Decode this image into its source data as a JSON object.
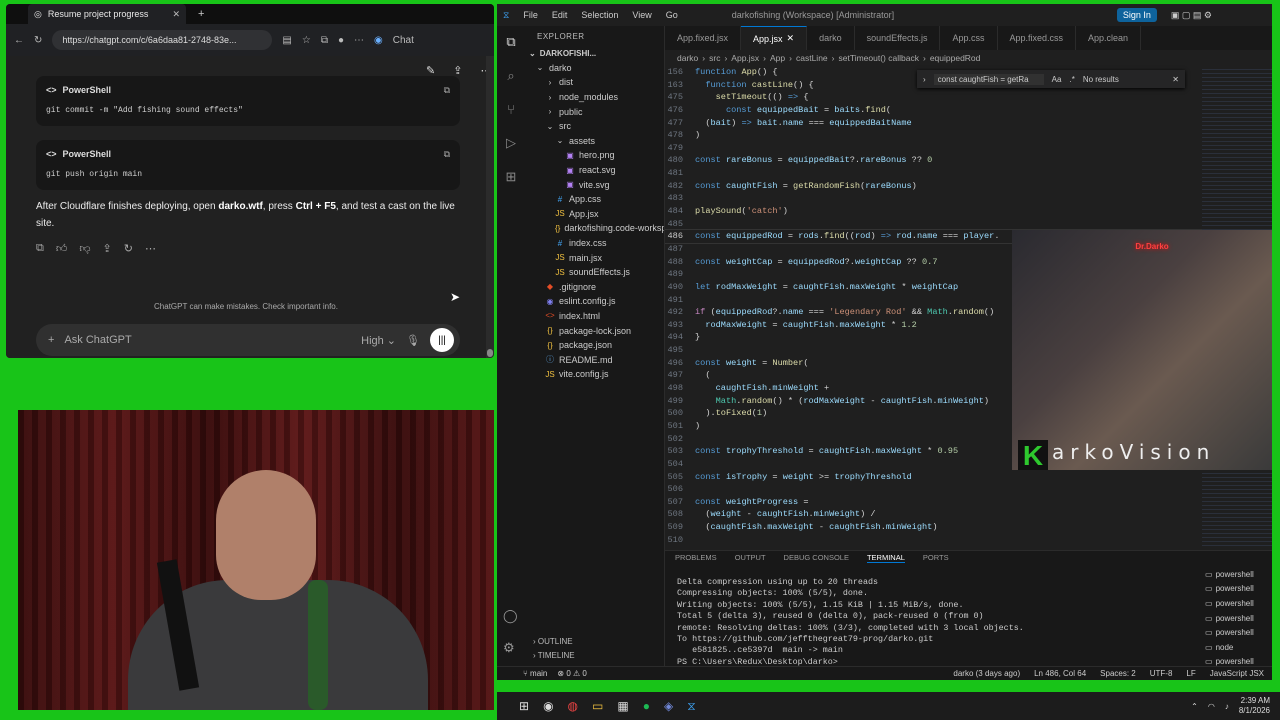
{
  "browser": {
    "tab_title": "Resume project progress",
    "url": "https://chatgpt.com/c/6a6daa81-2748-83e...",
    "chat_label": "Chat"
  },
  "chat": {
    "block1": {
      "lang": "PowerShell",
      "code": "git commit -m \"Add fishing sound effects\""
    },
    "block2": {
      "lang": "PowerShell",
      "code": "git push origin main"
    },
    "message_pre": "After Cloudflare finishes deploying, open ",
    "message_bold1": "darko.wtf",
    "message_mid": ", press ",
    "message_bold2": "Ctrl + F5",
    "message_post": ", and test a cast on the live site.",
    "disclaimer": "ChatGPT can make mistakes. Check important info.",
    "input_placeholder": "Ask ChatGPT",
    "model": "High"
  },
  "vscode": {
    "menu": [
      "File",
      "Edit",
      "Selection",
      "View",
      "Go"
    ],
    "window_title": "darkofishing (Workspace) [Administrator]",
    "sign_in": "Sign In",
    "explorer_header": "EXPLORER",
    "workspace": "DARKOFISHI...",
    "tree": [
      {
        "name": "darko",
        "type": "folder",
        "depth": 0,
        "open": true
      },
      {
        "name": "dist",
        "type": "folder",
        "depth": 1
      },
      {
        "name": "node_modules",
        "type": "folder",
        "depth": 1
      },
      {
        "name": "public",
        "type": "folder",
        "depth": 1
      },
      {
        "name": "src",
        "type": "folder",
        "depth": 1,
        "open": true
      },
      {
        "name": "assets",
        "type": "folder",
        "depth": 2,
        "open": true
      },
      {
        "name": "hero.png",
        "type": "img",
        "depth": 3
      },
      {
        "name": "react.svg",
        "type": "img",
        "depth": 3
      },
      {
        "name": "vite.svg",
        "type": "img",
        "depth": 3
      },
      {
        "name": "App.css",
        "type": "css",
        "depth": 2
      },
      {
        "name": "App.jsx",
        "type": "js",
        "depth": 2
      },
      {
        "name": "darkofishing.code-worksp...",
        "type": "json",
        "depth": 2
      },
      {
        "name": "index.css",
        "type": "css",
        "depth": 2
      },
      {
        "name": "main.jsx",
        "type": "js",
        "depth": 2
      },
      {
        "name": "soundEffects.js",
        "type": "js",
        "depth": 2
      },
      {
        "name": ".gitignore",
        "type": "git",
        "depth": 1
      },
      {
        "name": "eslint.config.js",
        "type": "eslint",
        "depth": 1
      },
      {
        "name": "index.html",
        "type": "html",
        "depth": 1
      },
      {
        "name": "package-lock.json",
        "type": "json",
        "depth": 1
      },
      {
        "name": "package.json",
        "type": "json",
        "depth": 1
      },
      {
        "name": "README.md",
        "type": "md",
        "depth": 1
      },
      {
        "name": "vite.config.js",
        "type": "js",
        "depth": 1
      }
    ],
    "outline": "OUTLINE",
    "timeline": "TIMELINE",
    "tabs": [
      "App.fixed.jsx",
      "App.jsx",
      "darko",
      "soundEffects.js",
      "App.css",
      "App.fixed.css",
      "App.clean"
    ],
    "active_tab": "App.jsx",
    "breadcrumbs": [
      "darko",
      "src",
      "App.jsx",
      "App",
      "castLine",
      "setTimeout() callback",
      "equippedRod"
    ],
    "find": {
      "query": "const caughtFish = getRa",
      "result": "No results"
    },
    "code_lines": [
      {
        "n": "156",
        "html": "<span class='kw'>function</span> <span class='fn'>App</span>() {"
      },
      {
        "n": "163",
        "html": "  <span class='kw'>function</span> <span class='fn'>castLine</span>() {"
      },
      {
        "n": "475",
        "html": "    <span class='fn'>setTimeout</span>(() <span class='kw'>=></span> {"
      },
      {
        "n": "476",
        "html": "      <span class='kw'>const</span> <span class='var'>equippedBait</span> = <span class='var'>baits</span>.<span class='fn'>find</span>("
      },
      {
        "n": "477",
        "html": "  (<span class='var'>bait</span>) <span class='kw'>=></span> <span class='var'>bait</span>.<span class='var'>name</span> === <span class='var'>equippedBaitName</span>"
      },
      {
        "n": "478",
        "html": ")"
      },
      {
        "n": "479",
        "html": ""
      },
      {
        "n": "480",
        "html": "<span class='kw'>const</span> <span class='var'>rareBonus</span> = <span class='var'>equippedBait</span>?.<span class='var'>rareBonus</span> ?? <span class='num'>0</span>"
      },
      {
        "n": "481",
        "html": ""
      },
      {
        "n": "482",
        "html": "<span class='kw'>const</span> <span class='var'>caughtFish</span> = <span class='fn'>getRandomFish</span>(<span class='var'>rareBonus</span>)"
      },
      {
        "n": "483",
        "html": ""
      },
      {
        "n": "484",
        "html": "<span class='fn'>playSound</span>(<span class='str'>'catch'</span>)"
      },
      {
        "n": "485",
        "html": ""
      },
      {
        "n": "486",
        "html": "<span class='kw'>const</span> <span class='var'>equippedRod</span> = <span class='var'>rods</span>.<span class='fn'>find</span>((<span class='var'>rod</span>) <span class='kw'>=></span> <span class='var'>rod</span>.<span class='var'>name</span> === <span class='var'>player</span>."
      },
      {
        "n": "487",
        "html": ""
      },
      {
        "n": "488",
        "html": "<span class='kw'>const</span> <span class='var'>weightCap</span> = <span class='var'>equippedRod</span>?.<span class='var'>weightCap</span> ?? <span class='num'>0.7</span>"
      },
      {
        "n": "489",
        "html": ""
      },
      {
        "n": "490",
        "html": "<span class='kw'>let</span> <span class='var'>rodMaxWeight</span> = <span class='var'>caughtFish</span>.<span class='var'>maxWeight</span> * <span class='var'>weightCap</span>"
      },
      {
        "n": "491",
        "html": ""
      },
      {
        "n": "492",
        "html": "<span class='ctl'>if</span> (<span class='var'>equippedRod</span>?.<span class='var'>name</span> === <span class='str'>'Legendary Rod'</span> &amp;&amp; <span class='cls'>Math</span>.<span class='fn'>random</span>()"
      },
      {
        "n": "493",
        "html": "  <span class='var'>rodMaxWeight</span> = <span class='var'>caughtFish</span>.<span class='var'>maxWeight</span> * <span class='num'>1.2</span>"
      },
      {
        "n": "494",
        "html": "}"
      },
      {
        "n": "495",
        "html": ""
      },
      {
        "n": "496",
        "html": "<span class='kw'>const</span> <span class='var'>weight</span> = <span class='fn'>Number</span>("
      },
      {
        "n": "497",
        "html": "  ("
      },
      {
        "n": "498",
        "html": "    <span class='var'>caughtFish</span>.<span class='var'>minWeight</span> +"
      },
      {
        "n": "499",
        "html": "    <span class='cls'>Math</span>.<span class='fn'>random</span>() * (<span class='var'>rodMaxWeight</span> - <span class='var'>caughtFish</span>.<span class='var'>minWeight</span>)"
      },
      {
        "n": "500",
        "html": "  ).<span class='fn'>toFixed</span>(<span class='num'>1</span>)"
      },
      {
        "n": "501",
        "html": ")"
      },
      {
        "n": "502",
        "html": ""
      },
      {
        "n": "503",
        "html": "<span class='kw'>const</span> <span class='var'>trophyThreshold</span> = <span class='var'>caughtFish</span>.<span class='var'>maxWeight</span> * <span class='num'>0.95</span>"
      },
      {
        "n": "504",
        "html": ""
      },
      {
        "n": "505",
        "html": "<span class='kw'>const</span> <span class='var'>isTrophy</span> = <span class='var'>weight</span> >= <span class='var'>trophyThreshold</span>"
      },
      {
        "n": "506",
        "html": ""
      },
      {
        "n": "507",
        "html": "<span class='kw'>const</span> <span class='var'>weightProgress</span> ="
      },
      {
        "n": "508",
        "html": "  (<span class='var'>weight</span> - <span class='var'>caughtFish</span>.<span class='var'>minWeight</span>) /"
      },
      {
        "n": "509",
        "html": "  (<span class='var'>caughtFish</span>.<span class='var'>maxWeight</span> - <span class='var'>caughtFish</span>.<span class='var'>minWeight</span>)"
      },
      {
        "n": "510",
        "html": ""
      }
    ],
    "current_line": "486",
    "panel_tabs": [
      "PROBLEMS",
      "OUTPUT",
      "DEBUG CONSOLE",
      "TERMINAL",
      "PORTS"
    ],
    "active_panel_tab": "TERMINAL",
    "terminal": "Delta compression using up to 20 threads\nCompressing objects: 100% (5/5), done.\nWriting objects: 100% (5/5), 1.15 KiB | 1.15 MiB/s, done.\nTotal 5 (delta 3), reused 0 (delta 0), pack-reused 0 (from 0)\nremote: Resolving deltas: 100% (3/3), completed with 3 local objects.\nTo https://github.com/jeffthegreat79-prog/darko.git\n   e581825..ce5397d  main -> main\nPS C:\\Users\\Redux\\Desktop\\darko> ",
    "terminal_list": [
      "powershell",
      "powershell",
      "powershell",
      "powershell",
      "powershell",
      "node",
      "powershell"
    ],
    "status": {
      "branch": "main",
      "errors": "0",
      "warnings": "0",
      "git_blame": "darko (3 days ago)",
      "position": "Ln 486, Col 64",
      "spaces": "Spaces: 2",
      "encoding": "UTF-8",
      "eol": "LF",
      "language": "JavaScript JSX"
    }
  },
  "overlay": {
    "brand": "arkoVision",
    "logo_letter": "K",
    "neon": "Dr.Darko"
  },
  "taskbar": {
    "time": "2:39 AM",
    "date": "8/1/2026"
  }
}
